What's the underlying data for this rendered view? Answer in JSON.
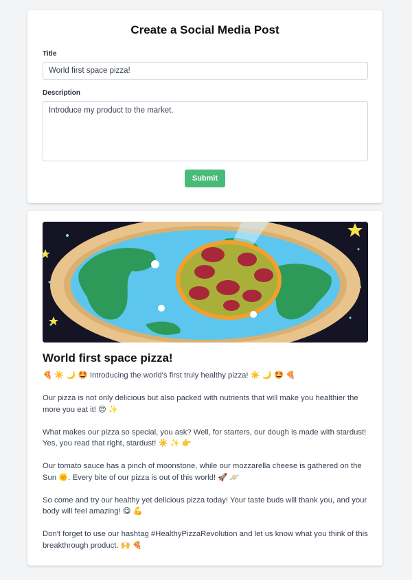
{
  "form": {
    "heading": "Create a Social Media Post",
    "title_label": "Title",
    "title_value": "World first space pizza!",
    "description_label": "Description",
    "description_value": "Introduce my product to the market.",
    "submit_label": "Submit"
  },
  "post": {
    "image_alt": "Pizza hovering over planet Earth in space",
    "title": "World first space pizza!",
    "paragraphs": [
      "🍕 ☀️ 🌙 🤩 Introducing the world's first truly healthy pizza! ☀️ 🌙 🤩 🍕",
      "Our pizza is not only delicious but also packed with nutrients that will make you healthier the more you eat it! 😍 ✨",
      "What makes our pizza so special, you ask? Well, for starters, our dough is made with stardust! Yes, you read that right, stardust! ☀️ ✨ 👉",
      "Our tomato sauce has a pinch of moonstone, while our mozzarella cheese is gathered on the Sun 🌞. Every bite of our pizza is out of this world! 🚀 🪐",
      "So come and try our healthy yet delicious pizza today! Your taste buds will thank you, and your body will feel amazing! 😋 💪",
      "Don't forget to use our hashtag #HealthyPizzaRevolution and let us know what you think of this breakthrough product. 🙌 🍕"
    ]
  },
  "colors": {
    "background": "#f3f4f6",
    "submit_button": "#48bb78",
    "text": "#374151"
  }
}
